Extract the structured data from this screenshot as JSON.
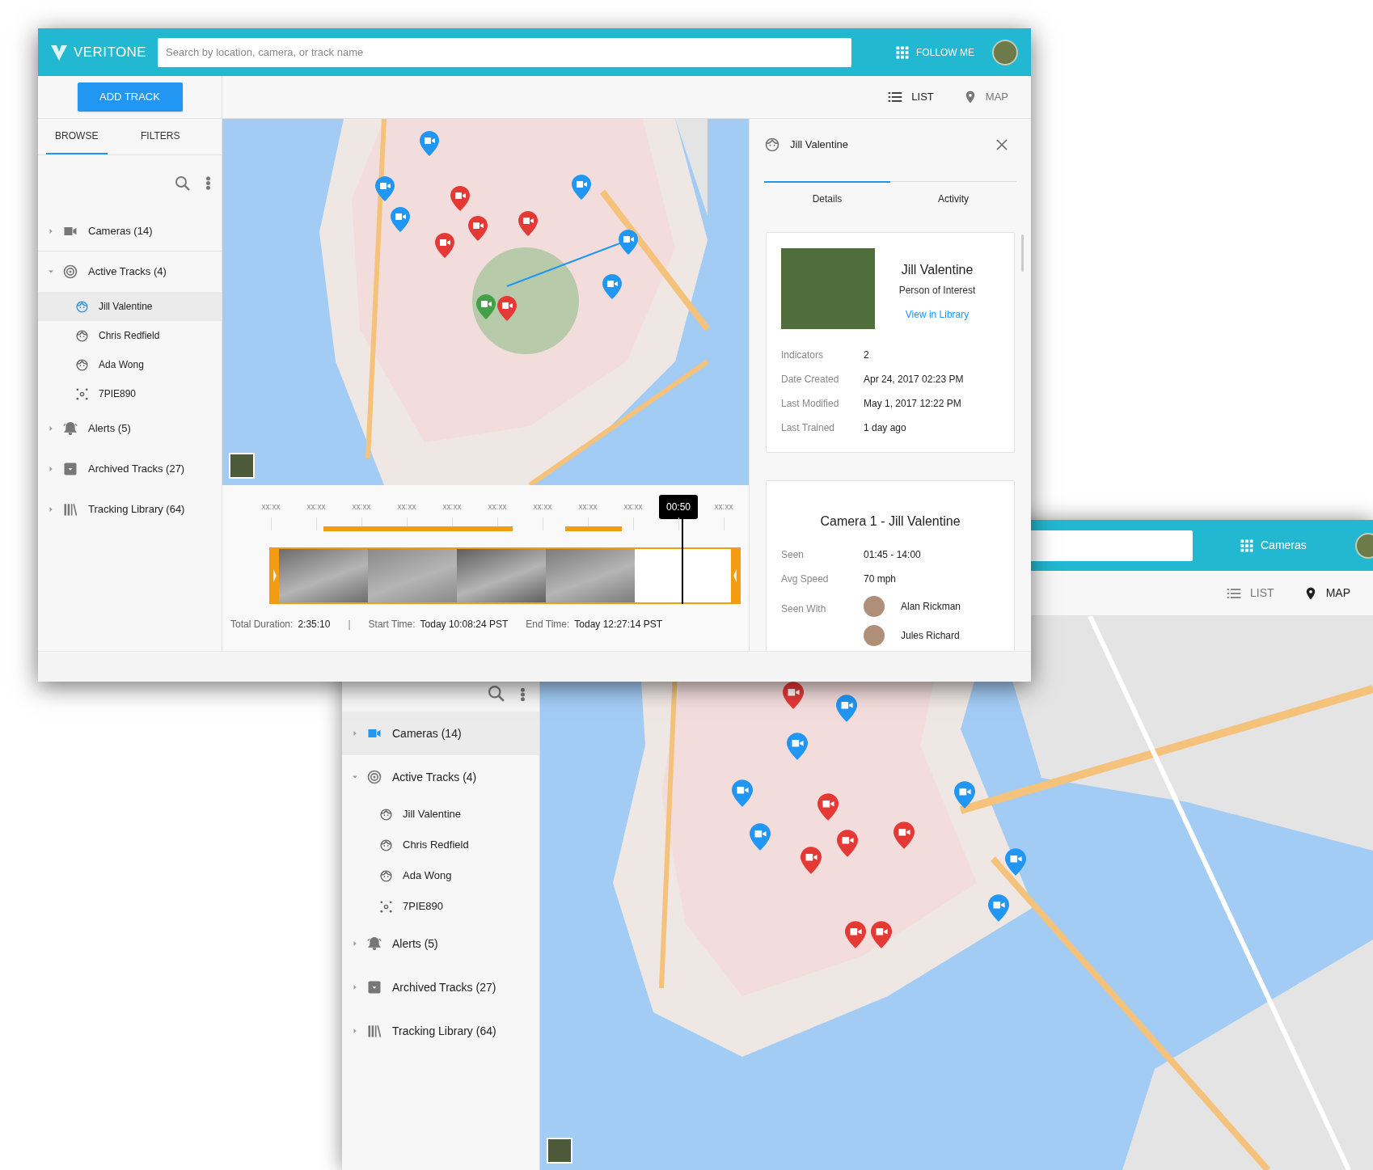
{
  "front_window": {
    "header": {
      "logo": "VERITONE",
      "search": {
        "placeholder": "Search by location, camera, or track name"
      },
      "apps_button": "FOLLOW ME"
    },
    "toolbar": {
      "add_button": "ADD TRACK",
      "views": [
        {
          "label": "LIST",
          "kind": "list",
          "selected": true
        },
        {
          "label": "MAP",
          "kind": "map",
          "selected": false
        }
      ]
    },
    "sidebar": {
      "tabs": [
        {
          "label": "BROWSE",
          "selected": true
        },
        {
          "label": "FILTERS",
          "selected": false
        }
      ],
      "tree": [
        {
          "label": "Cameras (14)",
          "kind": "camera",
          "expanded": false,
          "selected": false
        },
        {
          "label": "Active Tracks (4)",
          "kind": "radar",
          "expanded": true,
          "selected": false,
          "children": [
            {
              "label": "Jill Valentine",
              "kind": "face",
              "selected": true
            },
            {
              "label": "Chris Redfield",
              "kind": "face",
              "selected": false
            },
            {
              "label": "Ada Wong",
              "kind": "face",
              "selected": false
            },
            {
              "label": "7PIE890",
              "kind": "plate",
              "selected": false
            }
          ]
        },
        {
          "label": "Alerts (5)",
          "kind": "bell",
          "expanded": false,
          "selected": false
        },
        {
          "label": "Archived Tracks (27)",
          "kind": "archive",
          "expanded": false,
          "selected": false
        },
        {
          "label": "Tracking Library (64)",
          "kind": "library",
          "expanded": false,
          "selected": false
        }
      ]
    },
    "timeline": {
      "ticks": [
        "xx:xx",
        "xx:xx",
        "xx:xx",
        "xx:xx",
        "xx:xx",
        "xx:xx",
        "xx:xx",
        "xx:xx",
        "xx:xx",
        "xx:xx"
      ],
      "playhead": "00:50",
      "footer": [
        {
          "label": "Total Duration:",
          "value": "2:35:10"
        },
        {
          "label": "Start Time:",
          "value": "Today 10:08:24 PST"
        },
        {
          "label": "End Time:",
          "value": "Today 12:27:14 PST"
        }
      ],
      "separator": "|"
    },
    "panel": {
      "title": "Jill Valentine",
      "tabs": [
        {
          "label": "Details",
          "selected": true
        },
        {
          "label": "Activity",
          "selected": false
        }
      ],
      "profile": {
        "name": "Jill Valentine",
        "role": "Person of Interest",
        "link": "View in Library",
        "fields": [
          {
            "label": "Indicators",
            "value": "2"
          },
          {
            "label": "Date Created",
            "value": "Apr 24, 2017 02:23 PM"
          },
          {
            "label": "Last Modified",
            "value": "May 1, 2017 12:22 PM"
          },
          {
            "label": "Last Trained",
            "value": "1 day ago"
          }
        ]
      },
      "camera_card": {
        "title": "Camera 1 - Jill Valentine",
        "fields": [
          {
            "label": "Seen",
            "value": "01:45 - 14:00"
          },
          {
            "label": "Avg Speed",
            "value": "70 mph"
          }
        ],
        "seen_with": {
          "label": "Seen With",
          "people": [
            "Alan Rickman",
            "Jules Richard"
          ]
        }
      }
    }
  },
  "back_window": {
    "header": {
      "apps_button": "Cameras"
    },
    "toolbar": {
      "views": [
        {
          "label": "LIST",
          "kind": "list",
          "selected": false
        },
        {
          "label": "MAP",
          "kind": "map",
          "selected": true
        }
      ]
    },
    "sidebar": {
      "tree": [
        {
          "label": "Cameras (14)",
          "kind": "camera",
          "expanded": false,
          "selected": true
        },
        {
          "label": "Active Tracks (4)",
          "kind": "radar",
          "expanded": true,
          "selected": false,
          "children": [
            {
              "label": "Jill Valentine",
              "kind": "face",
              "selected": false
            },
            {
              "label": "Chris Redfield",
              "kind": "face",
              "selected": false
            },
            {
              "label": "Ada Wong",
              "kind": "face",
              "selected": false
            },
            {
              "label": "7PIE890",
              "kind": "plate",
              "selected": false
            }
          ]
        },
        {
          "label": "Alerts (5)",
          "kind": "bell",
          "expanded": false,
          "selected": false
        },
        {
          "label": "Archived Tracks (27)",
          "kind": "archive",
          "expanded": false,
          "selected": false
        },
        {
          "label": "Tracking Library (64)",
          "kind": "library",
          "expanded": false,
          "selected": false
        }
      ]
    }
  }
}
